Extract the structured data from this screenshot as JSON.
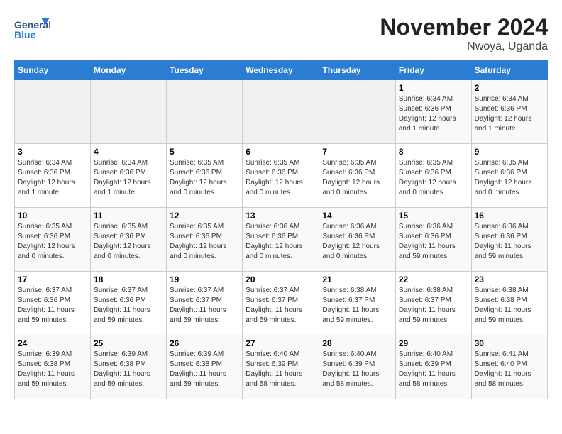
{
  "logo": {
    "text_general": "General",
    "text_blue": "Blue"
  },
  "title": "November 2024",
  "subtitle": "Nwoya, Uganda",
  "weekdays": [
    "Sunday",
    "Monday",
    "Tuesday",
    "Wednesday",
    "Thursday",
    "Friday",
    "Saturday"
  ],
  "weeks": [
    [
      {
        "day": "",
        "info": ""
      },
      {
        "day": "",
        "info": ""
      },
      {
        "day": "",
        "info": ""
      },
      {
        "day": "",
        "info": ""
      },
      {
        "day": "",
        "info": ""
      },
      {
        "day": "1",
        "info": "Sunrise: 6:34 AM\nSunset: 6:36 PM\nDaylight: 12 hours and 1 minute."
      },
      {
        "day": "2",
        "info": "Sunrise: 6:34 AM\nSunset: 6:36 PM\nDaylight: 12 hours and 1 minute."
      }
    ],
    [
      {
        "day": "3",
        "info": "Sunrise: 6:34 AM\nSunset: 6:36 PM\nDaylight: 12 hours and 1 minute."
      },
      {
        "day": "4",
        "info": "Sunrise: 6:34 AM\nSunset: 6:36 PM\nDaylight: 12 hours and 1 minute."
      },
      {
        "day": "5",
        "info": "Sunrise: 6:35 AM\nSunset: 6:36 PM\nDaylight: 12 hours and 0 minutes."
      },
      {
        "day": "6",
        "info": "Sunrise: 6:35 AM\nSunset: 6:36 PM\nDaylight: 12 hours and 0 minutes."
      },
      {
        "day": "7",
        "info": "Sunrise: 6:35 AM\nSunset: 6:36 PM\nDaylight: 12 hours and 0 minutes."
      },
      {
        "day": "8",
        "info": "Sunrise: 6:35 AM\nSunset: 6:36 PM\nDaylight: 12 hours and 0 minutes."
      },
      {
        "day": "9",
        "info": "Sunrise: 6:35 AM\nSunset: 6:36 PM\nDaylight: 12 hours and 0 minutes."
      }
    ],
    [
      {
        "day": "10",
        "info": "Sunrise: 6:35 AM\nSunset: 6:36 PM\nDaylight: 12 hours and 0 minutes."
      },
      {
        "day": "11",
        "info": "Sunrise: 6:35 AM\nSunset: 6:36 PM\nDaylight: 12 hours and 0 minutes."
      },
      {
        "day": "12",
        "info": "Sunrise: 6:35 AM\nSunset: 6:36 PM\nDaylight: 12 hours and 0 minutes."
      },
      {
        "day": "13",
        "info": "Sunrise: 6:36 AM\nSunset: 6:36 PM\nDaylight: 12 hours and 0 minutes."
      },
      {
        "day": "14",
        "info": "Sunrise: 6:36 AM\nSunset: 6:36 PM\nDaylight: 12 hours and 0 minutes."
      },
      {
        "day": "15",
        "info": "Sunrise: 6:36 AM\nSunset: 6:36 PM\nDaylight: 11 hours and 59 minutes."
      },
      {
        "day": "16",
        "info": "Sunrise: 6:36 AM\nSunset: 6:36 PM\nDaylight: 11 hours and 59 minutes."
      }
    ],
    [
      {
        "day": "17",
        "info": "Sunrise: 6:37 AM\nSunset: 6:36 PM\nDaylight: 11 hours and 59 minutes."
      },
      {
        "day": "18",
        "info": "Sunrise: 6:37 AM\nSunset: 6:36 PM\nDaylight: 11 hours and 59 minutes."
      },
      {
        "day": "19",
        "info": "Sunrise: 6:37 AM\nSunset: 6:37 PM\nDaylight: 11 hours and 59 minutes."
      },
      {
        "day": "20",
        "info": "Sunrise: 6:37 AM\nSunset: 6:37 PM\nDaylight: 11 hours and 59 minutes."
      },
      {
        "day": "21",
        "info": "Sunrise: 6:38 AM\nSunset: 6:37 PM\nDaylight: 11 hours and 59 minutes."
      },
      {
        "day": "22",
        "info": "Sunrise: 6:38 AM\nSunset: 6:37 PM\nDaylight: 11 hours and 59 minutes."
      },
      {
        "day": "23",
        "info": "Sunrise: 6:38 AM\nSunset: 6:38 PM\nDaylight: 11 hours and 59 minutes."
      }
    ],
    [
      {
        "day": "24",
        "info": "Sunrise: 6:39 AM\nSunset: 6:38 PM\nDaylight: 11 hours and 59 minutes."
      },
      {
        "day": "25",
        "info": "Sunrise: 6:39 AM\nSunset: 6:38 PM\nDaylight: 11 hours and 59 minutes."
      },
      {
        "day": "26",
        "info": "Sunrise: 6:39 AM\nSunset: 6:38 PM\nDaylight: 11 hours and 59 minutes."
      },
      {
        "day": "27",
        "info": "Sunrise: 6:40 AM\nSunset: 6:39 PM\nDaylight: 11 hours and 58 minutes."
      },
      {
        "day": "28",
        "info": "Sunrise: 6:40 AM\nSunset: 6:39 PM\nDaylight: 11 hours and 58 minutes."
      },
      {
        "day": "29",
        "info": "Sunrise: 6:40 AM\nSunset: 6:39 PM\nDaylight: 11 hours and 58 minutes."
      },
      {
        "day": "30",
        "info": "Sunrise: 6:41 AM\nSunset: 6:40 PM\nDaylight: 11 hours and 58 minutes."
      }
    ]
  ]
}
